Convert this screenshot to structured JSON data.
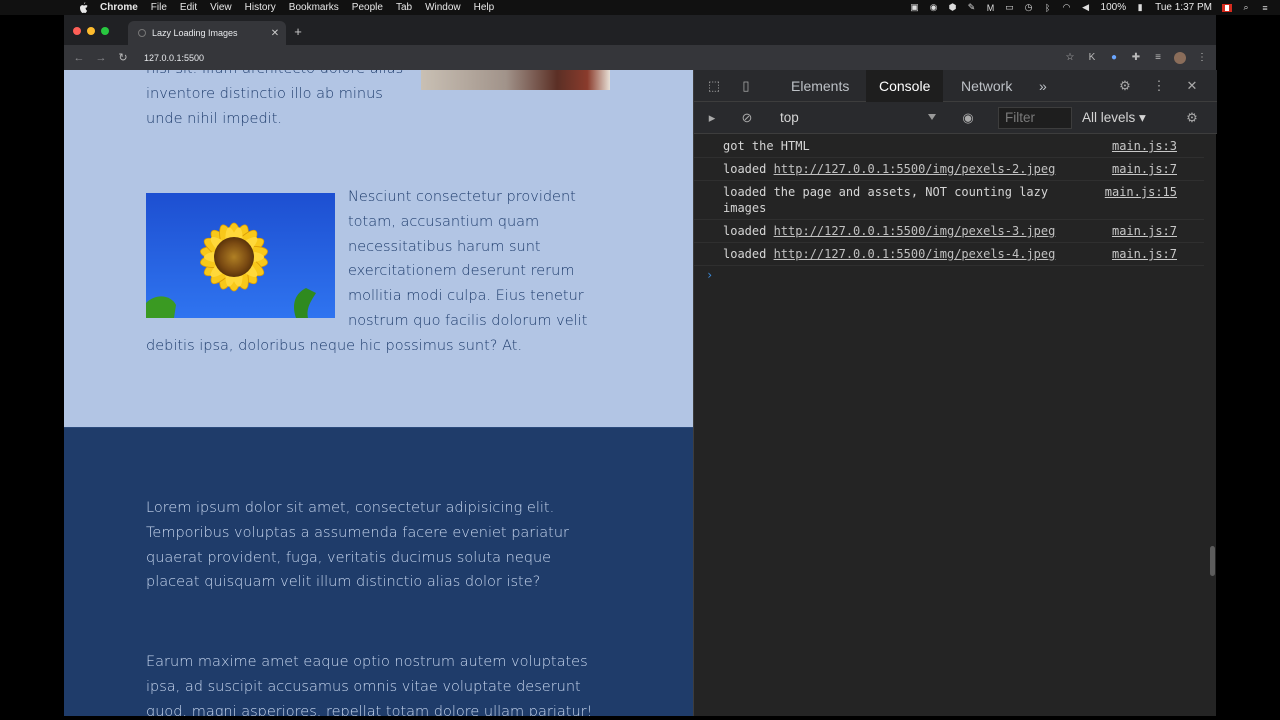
{
  "menubar": {
    "items": [
      "Chrome",
      "File",
      "Edit",
      "View",
      "History",
      "Bookmarks",
      "People",
      "Tab",
      "Window",
      "Help"
    ],
    "battery": "100%",
    "clock": "Tue 1:37 PM"
  },
  "browser": {
    "tab_title": "Lazy Loading Images",
    "url": "127.0.0.1:5500"
  },
  "page": {
    "top_fragment": "nisi sit. Illum architecto dolore alias inventore distinctio illo ab minus unde nihil impedit.",
    "sunflower_paragraph": "Nesciunt consectetur provident totam, accusantium quam necessitatibus harum sunt exercitationem deserunt rerum mollitia modi culpa. Eius tenetur nostrum quo facilis dolorum velit debitis ipsa, doloribus neque hic possimus sunt? At.",
    "dark_paragraph_1": "Lorem ipsum dolor sit amet, consectetur adipisicing elit. Temporibus voluptas a assumenda facere eveniet pariatur quaerat provident, fuga, veritatis ducimus soluta neque placeat quisquam velit illum distinctio alias dolor iste?",
    "dark_paragraph_2": "Earum maxime amet eaque optio nostrum autem voluptates ipsa, ad suscipit accusamus omnis vitae voluptate deserunt quod, magni asperiores, repellat totam dolore ullam pariatur!"
  },
  "devtools": {
    "tabs": [
      "Elements",
      "Console",
      "Network"
    ],
    "active_tab": "Console",
    "more": "»",
    "context": "top",
    "filter_placeholder": "Filter",
    "levels": "All levels ▾",
    "console": [
      {
        "prefix": "got the HTML",
        "link": "",
        "source": "main.js:3"
      },
      {
        "prefix": "loaded ",
        "link": "http://127.0.0.1:5500/img/pexels-2.jpeg",
        "source": "main.js:7"
      },
      {
        "prefix": "loaded the page and assets, NOT counting lazy images",
        "link": "",
        "source": "main.js:15"
      },
      {
        "prefix": "loaded ",
        "link": "http://127.0.0.1:5500/img/pexels-3.jpeg",
        "source": "main.js:7"
      },
      {
        "prefix": "loaded ",
        "link": "http://127.0.0.1:5500/img/pexels-4.jpeg",
        "source": "main.js:7"
      }
    ],
    "prompt": "›"
  },
  "colors": {
    "traffic_red": "#fe5f57",
    "traffic_yellow": "#febc2e",
    "traffic_green": "#28c840",
    "page_light": "#b2c5e4",
    "page_dark": "#1f3c6a",
    "devtools_bg": "#242424"
  }
}
